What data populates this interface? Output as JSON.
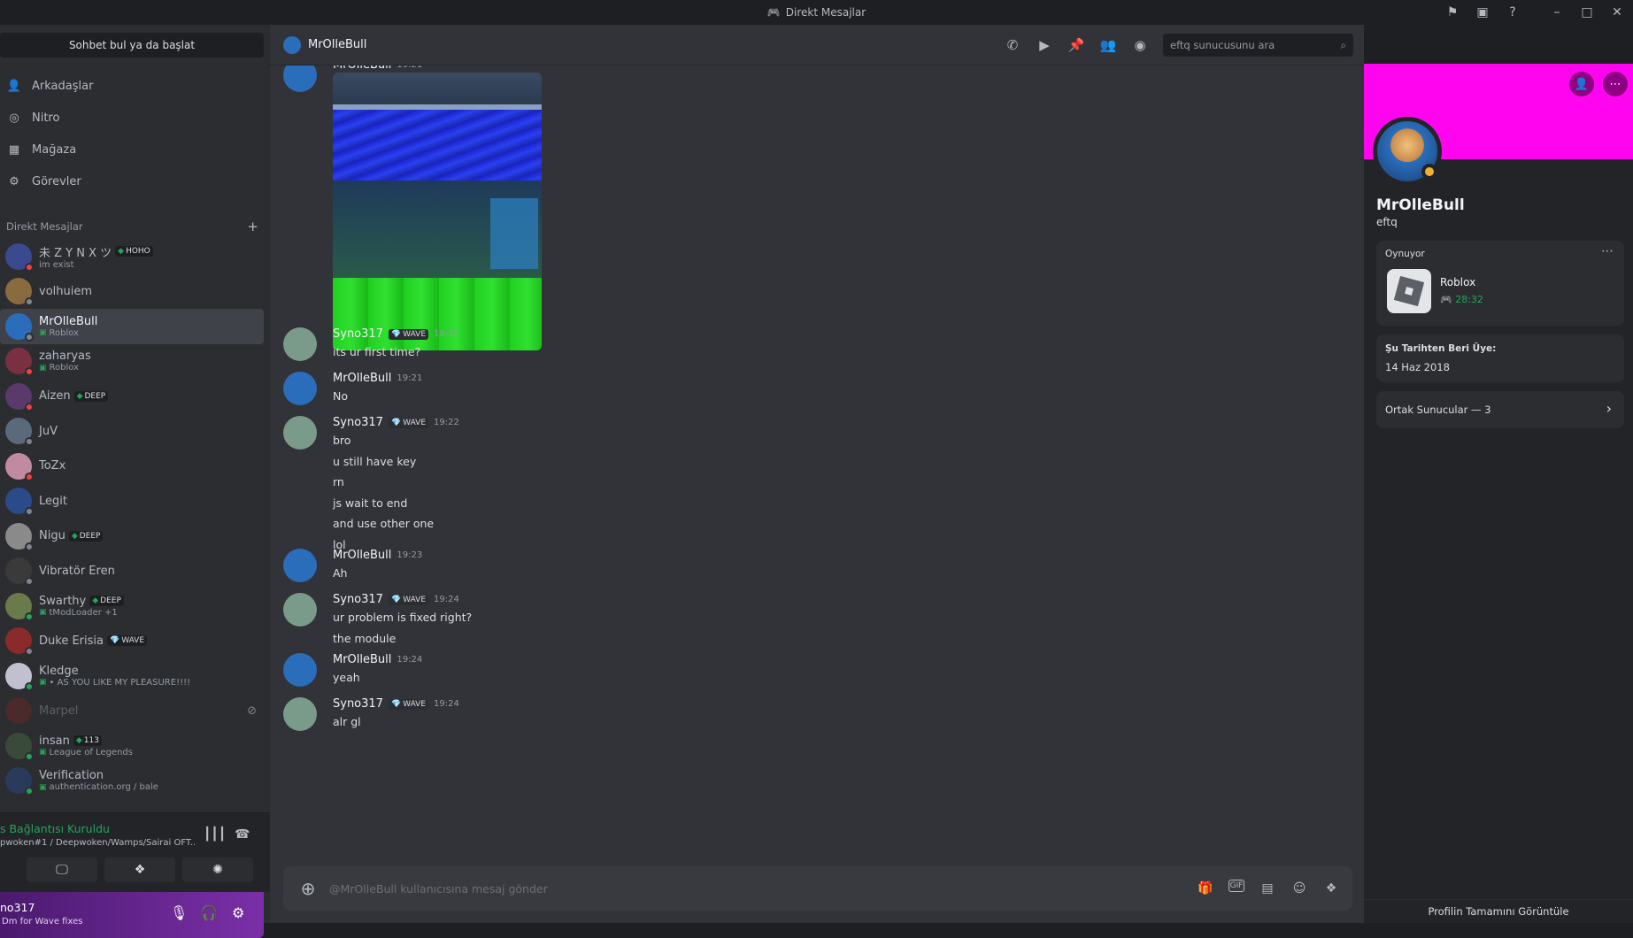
{
  "window": {
    "title": "Direkt Mesajlar"
  },
  "sidebar": {
    "search_label": "Sohbet bul ya da başlat",
    "nav": [
      {
        "label": "Arkadaşlar",
        "icon": "friends-icon"
      },
      {
        "label": "Nitro",
        "icon": "nitro-icon"
      },
      {
        "label": "Mağaza",
        "icon": "shop-icon"
      },
      {
        "label": "Görevler",
        "icon": "quests-icon"
      }
    ],
    "dm_header": "Direkt Mesajlar",
    "dms": [
      {
        "name": "未 Z Y N X ツ",
        "tag": "HOHO",
        "sub": "im exist",
        "status": "dnd",
        "color": "#3b4a8f"
      },
      {
        "name": "volhuiem",
        "tag": "",
        "sub": "",
        "status": "offline",
        "color": "#8a6a3f"
      },
      {
        "name": "MrOlleBull",
        "tag": "",
        "sub": "Roblox",
        "status": "idle",
        "color": "#2a6ebb"
      },
      {
        "name": "zaharyas",
        "tag": "",
        "sub": "Roblox",
        "status": "dnd",
        "color": "#7a3040"
      },
      {
        "name": "Aizen",
        "tag": "DEEP",
        "sub": "",
        "status": "dnd",
        "color": "#5a3a6a"
      },
      {
        "name": "JuV",
        "tag": "",
        "sub": "",
        "status": "offline",
        "color": "#5a6a7a"
      },
      {
        "name": "ToZx",
        "tag": "",
        "sub": "",
        "status": "dnd",
        "color": "#c08aa0"
      },
      {
        "name": "Legit",
        "tag": "",
        "sub": "",
        "status": "offline",
        "color": "#2a4a8a"
      },
      {
        "name": "Nigu",
        "tag": "DEEP",
        "sub": "",
        "status": "offline",
        "color": "#8a8a8a"
      },
      {
        "name": "Vibratör Eren",
        "tag": "",
        "sub": "",
        "status": "offline",
        "color": "#3a3a3a"
      },
      {
        "name": "Swarthy",
        "tag": "DEEP",
        "sub": "tModLoader +1",
        "status": "online",
        "color": "#6a7a4a"
      },
      {
        "name": "Duke Erisia",
        "tag": "WAVE",
        "sub": "",
        "status": "offline",
        "color": "#8a2a2a"
      },
      {
        "name": "Kledge",
        "tag": "",
        "sub": "• AS YOU LIKE MY PLEASURE!!!!",
        "status": "online",
        "color": "#c0c0d0"
      },
      {
        "name": "Marpel",
        "tag": "",
        "sub": "",
        "status": "muted",
        "color": "#4a2a2a"
      },
      {
        "name": "insan",
        "tag": "113",
        "sub": "League of Legends",
        "status": "online",
        "color": "#3a4a3a"
      },
      {
        "name": "Verification",
        "tag": "",
        "sub": "authentication.org / bale",
        "status": "online",
        "color": "#2a3a5a"
      }
    ]
  },
  "voice": {
    "status": "s Bağlantısı Kuruldu",
    "channel": "pwoken#1 / Deepwoken/Wamps/Sairai OFT..."
  },
  "user": {
    "name": "no317",
    "status": "Dm for Wave fixes"
  },
  "chat": {
    "header_name": "MrOlleBull",
    "search_placeholder": "eftq sunucusunu ara",
    "composer_placeholder": "@MrOlleBull kullanıcısına mesaj gönder",
    "messages": [
      {
        "author": "MrOlleBull",
        "tag": "",
        "time": "19:21",
        "lines": []
      },
      {
        "author": "Syno317",
        "tag": "WAVE",
        "time": "19:21",
        "lines": [
          "its ur first time?"
        ]
      },
      {
        "author": "MrOlleBull",
        "tag": "",
        "time": "19:21",
        "lines": [
          "No"
        ]
      },
      {
        "author": "Syno317",
        "tag": "WAVE",
        "time": "19:22",
        "lines": [
          "bro",
          "u still have key",
          "rn",
          "js wait to end",
          "and use other one",
          "lol"
        ]
      },
      {
        "author": "MrOlleBull",
        "tag": "",
        "time": "19:23",
        "lines": [
          "Ah"
        ]
      },
      {
        "author": "Syno317",
        "tag": "WAVE",
        "time": "19:24",
        "lines": [
          "ur problem is fixed right?",
          "the module"
        ]
      },
      {
        "author": "MrOlleBull",
        "tag": "",
        "time": "19:24",
        "lines": [
          "yeah"
        ]
      },
      {
        "author": "Syno317",
        "tag": "WAVE",
        "time": "19:24",
        "lines": [
          "alr gl"
        ]
      }
    ]
  },
  "profile": {
    "display_name": "MrOlleBull",
    "username": "eftq",
    "activity_label": "Oynuyor",
    "game": "Roblox",
    "game_time": "28:32",
    "member_since_label": "Şu Tarihten Beri Üye:",
    "member_since": "14 Haz 2018",
    "mutual_servers": "Ortak Sunucular — 3",
    "view_full": "Profilin Tamamını Görüntüle"
  }
}
